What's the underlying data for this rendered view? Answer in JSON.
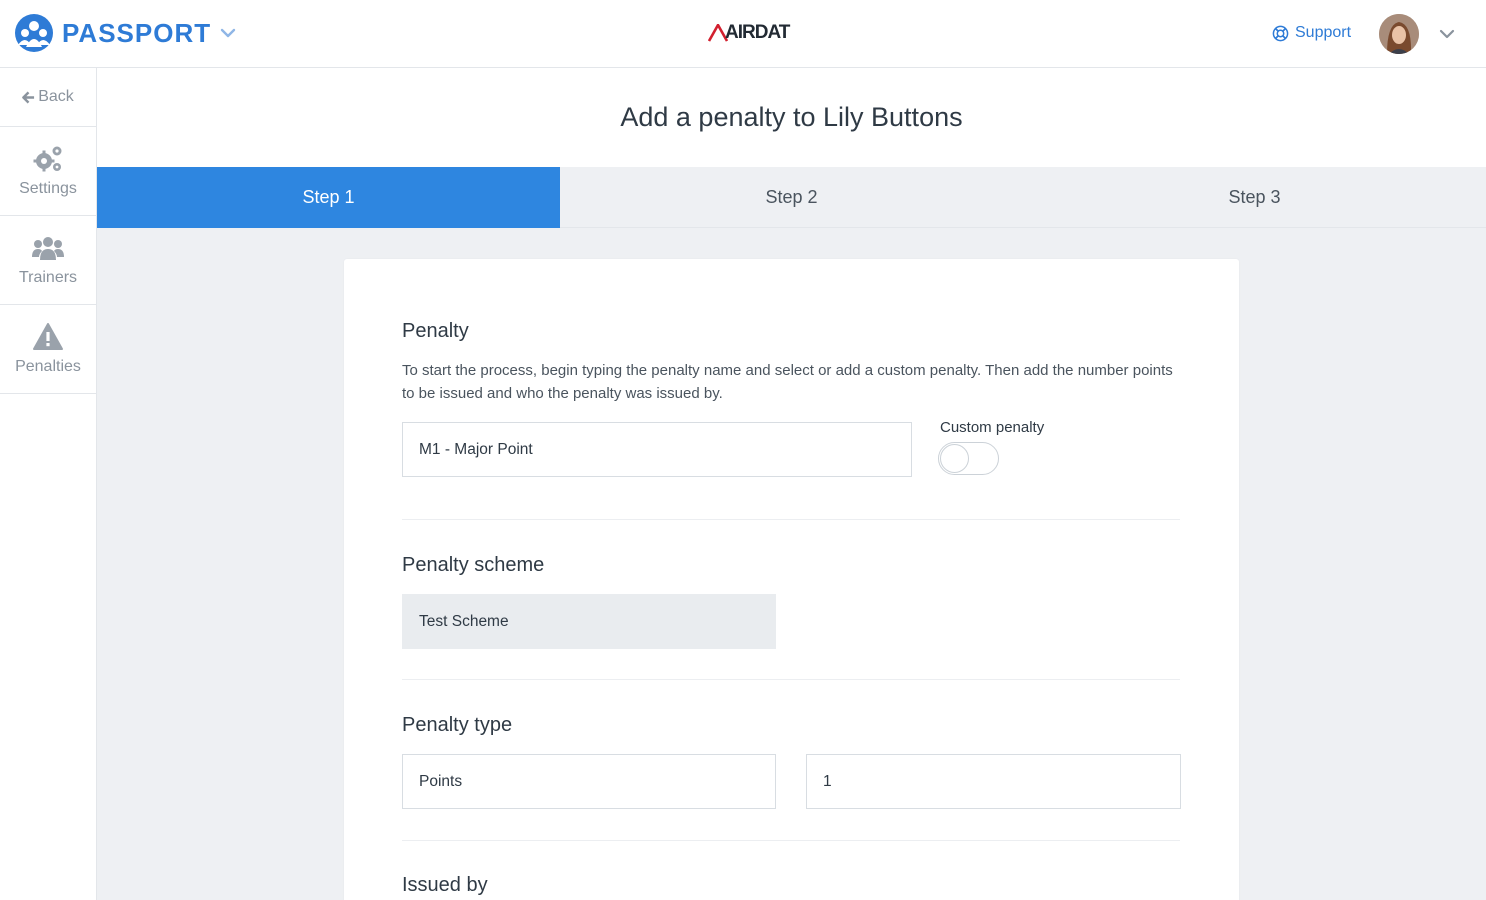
{
  "header": {
    "brand_name": "PASSPORT",
    "center_logo": "AIRDAT",
    "support_label": "Support"
  },
  "sidebar": {
    "back_label": "Back",
    "items": [
      {
        "label": "Settings",
        "icon": "gears-icon"
      },
      {
        "label": "Trainers",
        "icon": "users-icon"
      },
      {
        "label": "Penalties",
        "icon": "warning-icon"
      }
    ]
  },
  "page": {
    "title": "Add a penalty to Lily Buttons"
  },
  "steps": [
    {
      "label": "Step 1",
      "active": true
    },
    {
      "label": "Step 2",
      "active": false
    },
    {
      "label": "Step 3",
      "active": false
    }
  ],
  "form": {
    "penalty": {
      "title": "Penalty",
      "description": "To start the process, begin typing the penalty name and select or add a custom penalty. Then add the number points to be issued and who the penalty was issued by.",
      "value": "M1 - Major Point",
      "custom_label": "Custom penalty",
      "custom_on": false
    },
    "scheme": {
      "title": "Penalty scheme",
      "value": "Test Scheme"
    },
    "type": {
      "title": "Penalty type",
      "value": "Points",
      "amount": "1"
    },
    "issued_by": {
      "title": "Issued by"
    }
  },
  "colors": {
    "accent": "#2e86e0",
    "brand": "#2e7bd6"
  }
}
